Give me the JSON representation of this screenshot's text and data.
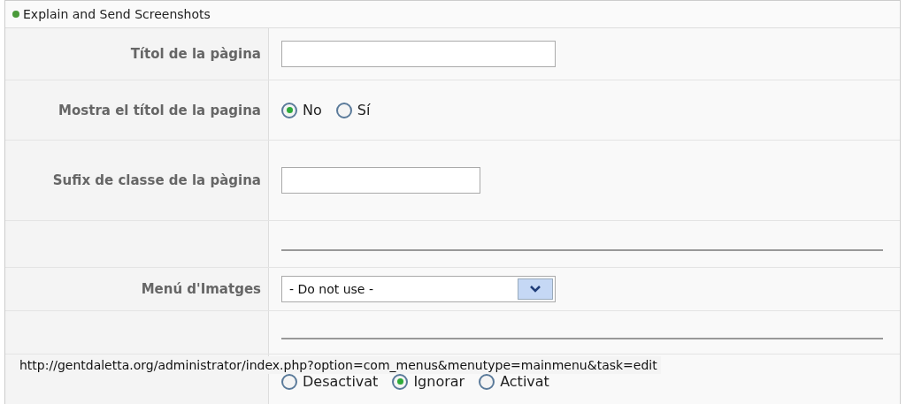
{
  "header": {
    "title": "Explain and Send Screenshots"
  },
  "rows": [
    {
      "kind": "text",
      "label": "Títol de la pàgina",
      "value": ""
    },
    {
      "kind": "radio",
      "label": "Mostra el títol de la pagina",
      "options": [
        {
          "label": "No",
          "selected": true
        },
        {
          "label": "Sí",
          "selected": false
        }
      ]
    },
    {
      "kind": "shorttext",
      "label": "Sufix de classe de la pàgina",
      "value": ""
    },
    {
      "kind": "rule"
    },
    {
      "kind": "select",
      "label": "Menú d'Imatges",
      "value": "- Do not use -"
    },
    {
      "kind": "rule"
    },
    {
      "kind": "radio",
      "options": [
        {
          "label": "Desactivat",
          "selected": false
        },
        {
          "label": "Ignorar",
          "selected": true
        },
        {
          "label": "Activat",
          "selected": false
        }
      ]
    }
  ],
  "status_bar": {
    "url": "http://gentdaletta.org/administrator/index.php?option=com_menus&menutype=mainmenu&task=edit"
  }
}
